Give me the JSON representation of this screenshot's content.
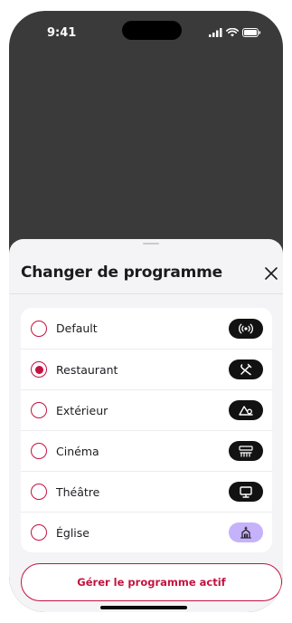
{
  "status_bar": {
    "time": "9:41"
  },
  "sheet": {
    "title": "Changer de programme",
    "programs": [
      {
        "label": "Default",
        "selected": false,
        "icon": "radio-waves-icon"
      },
      {
        "label": "Restaurant",
        "selected": true,
        "icon": "utensils-icon"
      },
      {
        "label": "Extérieur",
        "selected": false,
        "icon": "mountain-icon"
      },
      {
        "label": "Cinéma",
        "selected": false,
        "icon": "cinema-seats-icon"
      },
      {
        "label": "Théâtre",
        "selected": false,
        "icon": "monitor-icon"
      },
      {
        "label": "Église",
        "selected": false,
        "icon": "church-icon",
        "active_badge": true
      }
    ],
    "manage_button": "Gérer le programme actif"
  },
  "colors": {
    "accent": "#c4123f",
    "active_badge": "#c5b2fb",
    "badge": "#121212",
    "backdrop": "#3a3a3a",
    "sheet_bg": "#f4f3f5"
  }
}
